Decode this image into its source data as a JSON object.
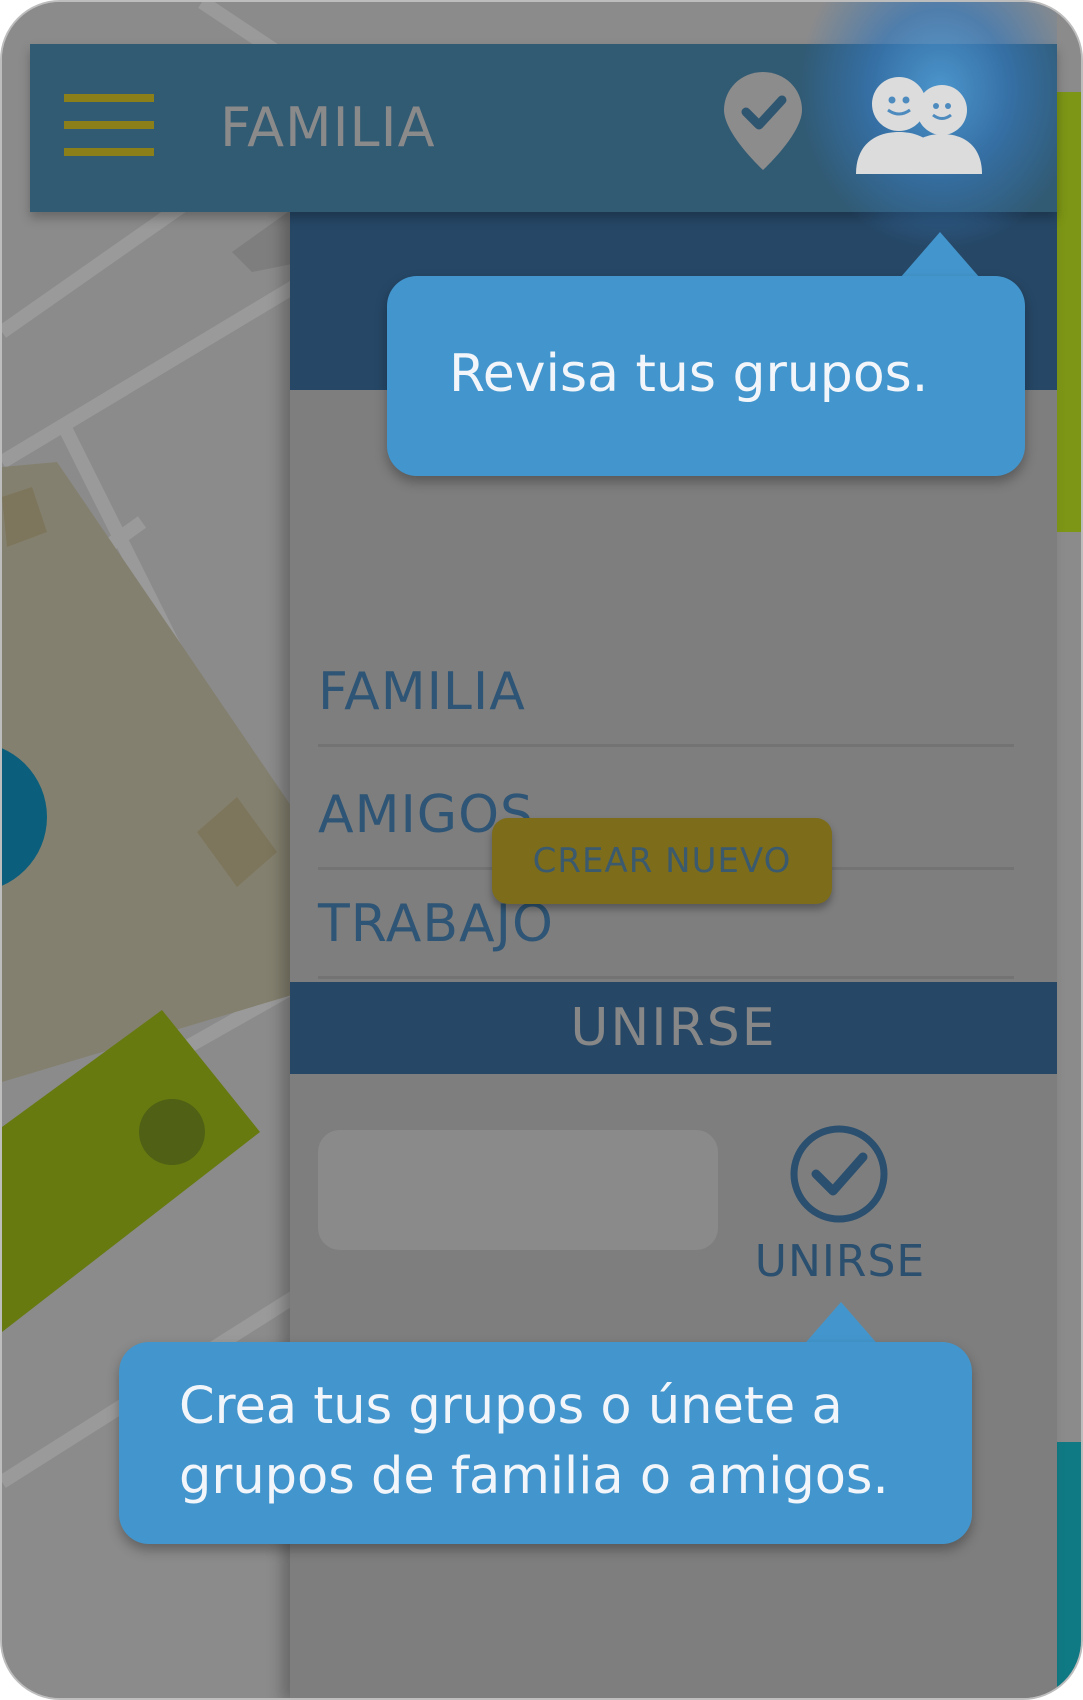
{
  "header": {
    "title": "FAMILIA",
    "menu_icon": "hamburger-menu-icon",
    "location_icon": "location-pin-check-icon",
    "groups_icon": "groups-people-icon"
  },
  "groups_panel": {
    "items": [
      {
        "label": "FAMILIA"
      },
      {
        "label": "AMIGOS"
      },
      {
        "label": "TRABAJO"
      }
    ],
    "create_button_label": "CREAR NUEVO",
    "join_section_title": "UNIRSE",
    "join_input_value": "",
    "join_button_label": "UNIRSE",
    "join_button_icon": "check-circle-icon"
  },
  "tooltips": {
    "groups_hint": "Revisa tus grupos.",
    "join_hint_line1": "Crea tus grupos o únete a",
    "join_hint_line2": "grupos de familia o amigos."
  },
  "colors": {
    "accent_blue": "#4396cd",
    "header_blue": "#315a73",
    "panel_dark_blue": "#264766",
    "button_gold": "#7d6d1b",
    "menu_gold": "#8a7f19"
  }
}
